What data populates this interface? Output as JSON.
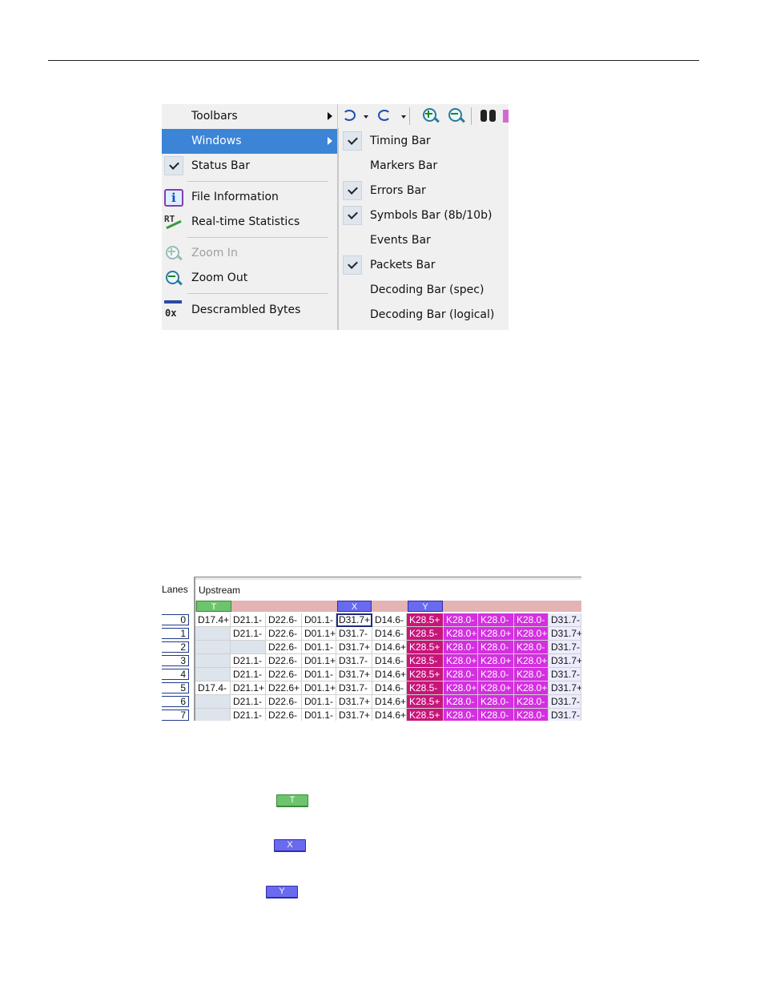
{
  "menu": {
    "items": [
      {
        "label": "Toolbars"
      },
      {
        "label": "Windows"
      },
      {
        "label": "Status Bar"
      },
      {
        "label": "File Information"
      },
      {
        "label": "Real-time Statistics"
      },
      {
        "label": "Zoom In"
      },
      {
        "label": "Zoom Out"
      },
      {
        "label": "Descrambled Bytes"
      }
    ],
    "icons": {
      "file_information": "info-icon",
      "realtime": "rt-chart-icon",
      "descrambled": "0x-icon"
    },
    "rt_icon_text": "RT",
    "descrambled_icon_text": "0x"
  },
  "submenu": {
    "items": [
      {
        "label": "Timing Bar",
        "checked": true
      },
      {
        "label": "Markers Bar",
        "checked": false
      },
      {
        "label": "Errors Bar",
        "checked": true
      },
      {
        "label": "Symbols Bar (8b/10b)",
        "checked": true
      },
      {
        "label": "Events Bar",
        "checked": false
      },
      {
        "label": "Packets Bar",
        "checked": true
      },
      {
        "label": "Decoding Bar (spec)",
        "checked": false
      },
      {
        "label": "Decoding Bar (logical)",
        "checked": false
      }
    ]
  },
  "grid": {
    "lanes_header": "Lanes",
    "upstream_label": "Upstream",
    "markers": {
      "t": "T",
      "x": "X",
      "y": "Y"
    },
    "lanes": [
      "0",
      "1",
      "2",
      "3",
      "4",
      "5",
      "6",
      "7"
    ],
    "rows": [
      [
        "D17.4+",
        "D21.1-",
        "D22.6-",
        "D01.1-",
        "D31.7+",
        "D14.6-",
        "K28.5+",
        "K28.0-",
        "K28.0-",
        "K28.0-",
        "D31.7-"
      ],
      [
        "",
        "D21.1-",
        "D22.6-",
        "D01.1+",
        "D31.7-",
        "D14.6-",
        "K28.5-",
        "K28.0+",
        "K28.0+",
        "K28.0+",
        "D31.7+"
      ],
      [
        "",
        "",
        "D22.6-",
        "D01.1-",
        "D31.7+",
        "D14.6+",
        "K28.5+",
        "K28.0-",
        "K28.0-",
        "K28.0-",
        "D31.7-"
      ],
      [
        "",
        "D21.1-",
        "D22.6-",
        "D01.1+",
        "D31.7-",
        "D14.6-",
        "K28.5-",
        "K28.0+",
        "K28.0+",
        "K28.0+",
        "D31.7+"
      ],
      [
        "",
        "D21.1-",
        "D22.6-",
        "D01.1-",
        "D31.7+",
        "D14.6+",
        "K28.5+",
        "K28.0-",
        "K28.0-",
        "K28.0-",
        "D31.7-"
      ],
      [
        "D17.4-",
        "D21.1+",
        "D22.6+",
        "D01.1+",
        "D31.7-",
        "D14.6-",
        "K28.5-",
        "K28.0+",
        "K28.0+",
        "K28.0+",
        "D31.7+"
      ],
      [
        "",
        "D21.1-",
        "D22.6-",
        "D01.1-",
        "D31.7+",
        "D14.6+",
        "K28.5+",
        "K28.0-",
        "K28.0-",
        "K28.0-",
        "D31.7-"
      ],
      [
        "",
        "D21.1-",
        "D22.6-",
        "D01.1-",
        "D31.7+",
        "D14.6+",
        "K28.5+",
        "K28.0-",
        "K28.0-",
        "K28.0-",
        "D31.7-"
      ]
    ],
    "colors": {
      "k285": "#c8157a",
      "k280": "#d42fe0",
      "marker_t": "#6cc46c",
      "marker_xy": "#6a6af0",
      "marker_row": "#e4b3b3"
    }
  },
  "legend": {
    "t": "T",
    "x": "X",
    "y": "Y"
  }
}
